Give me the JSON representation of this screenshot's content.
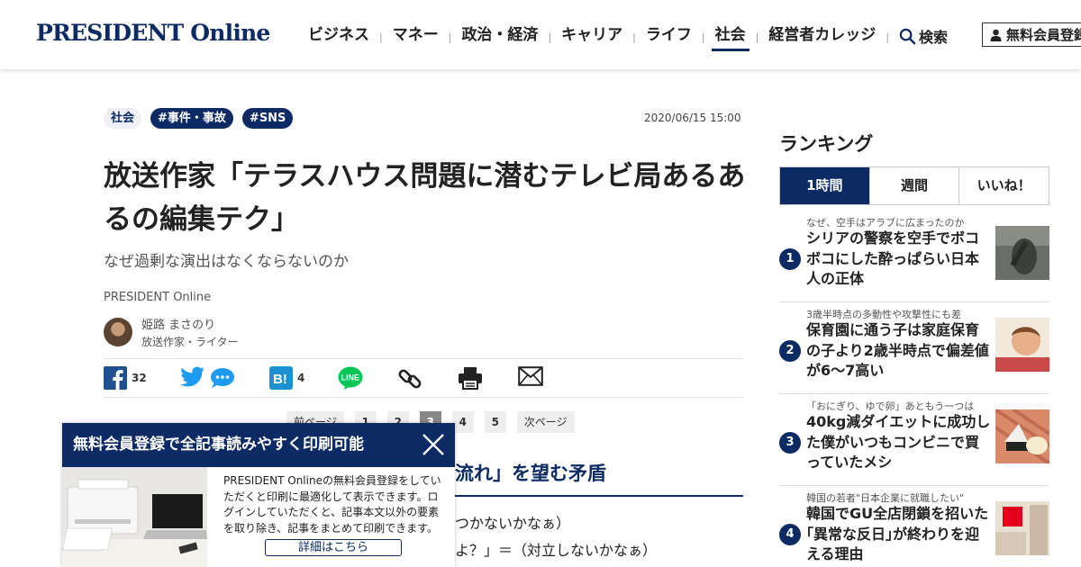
{
  "header": {
    "logo": "PRESIDENT Online",
    "nav": [
      {
        "label": "ビジネス",
        "active": false
      },
      {
        "label": "マネー",
        "active": false
      },
      {
        "label": "政治・経済",
        "active": false
      },
      {
        "label": "キャリア",
        "active": false
      },
      {
        "label": "ライフ",
        "active": false
      },
      {
        "label": "社会",
        "active": true
      },
      {
        "label": "経営者カレッジ",
        "active": false
      }
    ],
    "search_label": "検索",
    "register_label": "無料会員登録"
  },
  "article": {
    "tags": [
      "社会",
      "#事件・事故",
      "#SNS"
    ],
    "date": "2020/06/15 15:00",
    "title": "放送作家「テラスハウス問題に潜むテレビ局あるあるの編集テク」",
    "subtitle": "なぜ過剰な演出はなくならないのか",
    "source": "PRESIDENT Online",
    "author_name": "姫路 まさのり",
    "author_role": "放送作家・ライター",
    "share": {
      "facebook_count": "32",
      "hatena_count": "4"
    },
    "pager": {
      "prev": "前ページ",
      "pages": [
        "1",
        "2",
        "3",
        "4",
        "5"
      ],
      "current": "3",
      "next": "次ページ"
    },
    "section_heading": "流れ」を望む矛盾",
    "body_line1": "つかないかなぁ）",
    "body_line2": "よ？」＝（対立しないかなぁ）"
  },
  "popup": {
    "title": "無料会員登録で全記事読みやすく印刷可能",
    "text": "PRESIDENT Onlineの無料会員登録をしていただくと印刷に最適化して表示できます。ログインしていただくと、記事本文以外の要素を取り除き、記事をまとめて印刷できます。",
    "button": "詳細はこちら"
  },
  "ranking": {
    "title": "ランキング",
    "tabs": [
      {
        "label": "1時間",
        "active": true
      },
      {
        "label": "週間",
        "active": false
      },
      {
        "label": "いいね！",
        "active": false
      }
    ],
    "items": [
      {
        "rank": "1",
        "kicker": "なぜ、空手はアラブに広まったのか",
        "headline": "シリアの警察を空手でボコボコにした酔っぱらい日本人の正体"
      },
      {
        "rank": "2",
        "kicker": "3歳半時点の多動性や攻撃性にも差",
        "headline": "保育園に通う子は家庭保育の子より2歳半時点で偏差値が6～7高い"
      },
      {
        "rank": "3",
        "kicker": "「おにぎり、ゆで卵」あともう一つは",
        "headline": "40kg減ダイエットに成功した僕がいつもコンビニで買っていたメシ"
      },
      {
        "rank": "4",
        "kicker": "韓国の若者\"日本企業に就職したい\"",
        "headline": "韓国でGU全店閉鎖を招いた｢異常な反日｣が終わりを迎える理由"
      }
    ]
  },
  "colors": {
    "brand": "#0c2a63"
  }
}
